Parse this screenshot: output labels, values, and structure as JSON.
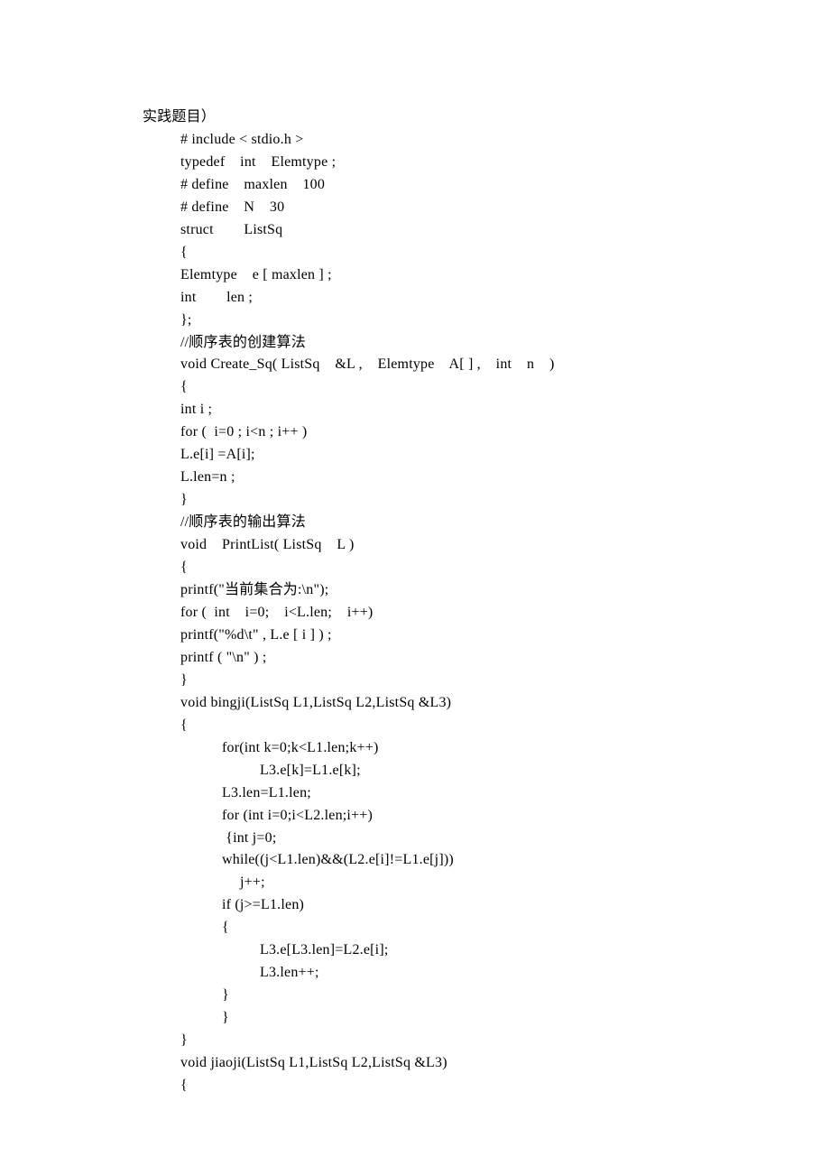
{
  "lines": [
    {
      "cls": "line",
      "text": "实践题目）"
    },
    {
      "cls": "line indent1",
      "text": "# include < stdio.h >"
    },
    {
      "cls": "line indent1",
      "text": "typedef    int    Elemtype ;"
    },
    {
      "cls": "line indent1",
      "text": "# define    maxlen    100"
    },
    {
      "cls": "line indent1",
      "text": "# define    N    30"
    },
    {
      "cls": "line indent1",
      "text": "struct        ListSq"
    },
    {
      "cls": "line indent1",
      "text": "{"
    },
    {
      "cls": "line indent1",
      "text": "Elemtype    e [ maxlen ] ;"
    },
    {
      "cls": "line indent1",
      "text": "int        len ;"
    },
    {
      "cls": "line indent1",
      "text": "};"
    },
    {
      "cls": "line indent1",
      "text": "//顺序表的创建算法"
    },
    {
      "cls": "line indent1",
      "text": "void Create_Sq( ListSq    &L ,    Elemtype    A[ ] ,    int    n    )"
    },
    {
      "cls": "line indent1",
      "text": "{"
    },
    {
      "cls": "line indent1",
      "text": "int i ;"
    },
    {
      "cls": "line indent1",
      "text": "for (  i=0 ; i<n ; i++ )"
    },
    {
      "cls": "line indent1",
      "text": "L.e[i] =A[i];"
    },
    {
      "cls": "line indent1",
      "text": "L.len=n ;"
    },
    {
      "cls": "line indent1",
      "text": "}"
    },
    {
      "cls": "line indent1",
      "text": "//顺序表的输出算法"
    },
    {
      "cls": "line indent1",
      "text": "void    PrintList( ListSq    L )"
    },
    {
      "cls": "line indent1",
      "text": "{"
    },
    {
      "cls": "line indent1",
      "text": "printf(\"当前集合为:\\n\");"
    },
    {
      "cls": "line indent1",
      "text": "for (  int    i=0;    i<L.len;    i++)"
    },
    {
      "cls": "line indent1",
      "text": "printf(\"%d\\t\" , L.e [ i ] ) ;"
    },
    {
      "cls": "line indent1",
      "text": "printf ( \"\\n\" ) ;"
    },
    {
      "cls": "line indent1",
      "text": "}"
    },
    {
      "cls": "line indent1",
      "text": "void bingji(ListSq L1,ListSq L2,ListSq &L3)"
    },
    {
      "cls": "line indent1",
      "text": "{"
    },
    {
      "cls": "line indent2",
      "text": "for(int k=0;k<L1.len;k++)"
    },
    {
      "cls": "line indent3",
      "text": "L3.e[k]=L1.e[k];"
    },
    {
      "cls": "line indent2",
      "text": "L3.len=L1.len;"
    },
    {
      "cls": "line indent2",
      "text": "for (int i=0;i<L2.len;i++)"
    },
    {
      "cls": "line indent2",
      "text": " {int j=0;"
    },
    {
      "cls": "line indent2",
      "text": "while((j<L1.len)&&(L2.e[i]!=L1.e[j]))"
    },
    {
      "cls": "line indent4",
      "text": "j++;"
    },
    {
      "cls": "line indent2",
      "text": "if (j>=L1.len)"
    },
    {
      "cls": "line indent2",
      "text": "{"
    },
    {
      "cls": "line indent3",
      "text": "L3.e[L3.len]=L2.e[i];"
    },
    {
      "cls": "line indent3",
      "text": "L3.len++;"
    },
    {
      "cls": "line indent2",
      "text": "}"
    },
    {
      "cls": "line indent2",
      "text": "}"
    },
    {
      "cls": "line indent1",
      "text": "}"
    },
    {
      "cls": "line indent1",
      "text": "void jiaoji(ListSq L1,ListSq L2,ListSq &L3)"
    },
    {
      "cls": "line indent1",
      "text": "{"
    }
  ]
}
